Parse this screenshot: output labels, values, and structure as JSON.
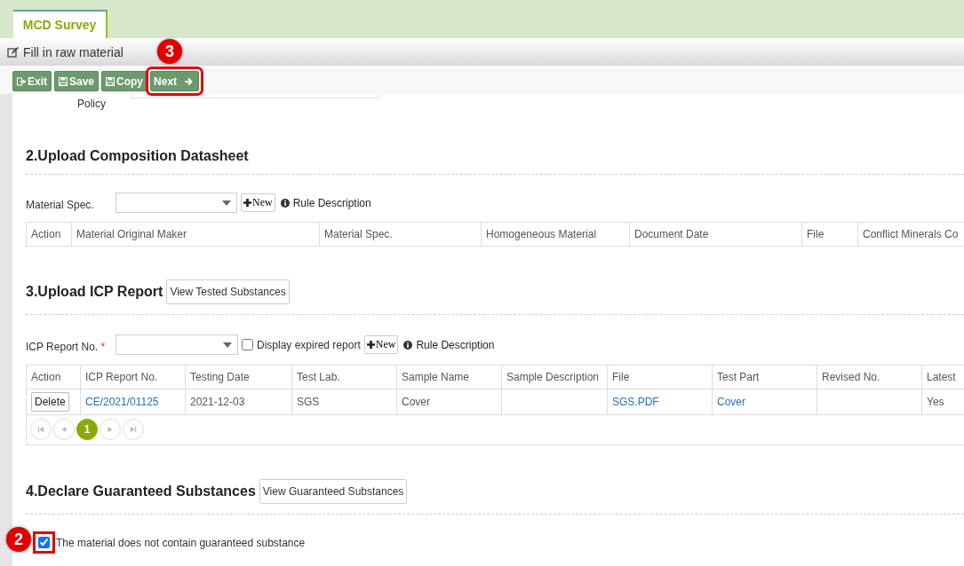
{
  "tabs": [
    {
      "label": "MCD Survey",
      "selected": true
    }
  ],
  "header": {
    "title": "Fill in raw material"
  },
  "toolbar": [
    {
      "label": "Exit",
      "kind": "exit"
    },
    {
      "label": "Save",
      "kind": "save"
    },
    {
      "label": "Copy",
      "kind": "save"
    },
    {
      "label": "Next",
      "kind": "next",
      "callout": "3"
    }
  ],
  "policy": {
    "label": "Policy"
  },
  "section_2": {
    "heading": "2.Upload Composition Datasheet",
    "field_label": "Material Spec.",
    "new_button": "New",
    "rule_link": "Rule Description",
    "table": {
      "columns": [
        "Action",
        "Material Original Maker",
        "Material Spec.",
        "Homogeneous Material",
        "Document Date",
        "File",
        "Conflict Minerals Co"
      ]
    }
  },
  "section_3": {
    "heading": "3.Upload ICP Report",
    "view_button": "View Tested Substances",
    "field_label": "ICP Report No.",
    "required_mark": "*",
    "expired_checkbox": {
      "label": "Display expired report",
      "checked": false
    },
    "new_button": "New",
    "rule_link": "Rule Description",
    "table": {
      "columns": [
        "Action",
        "ICP Report No.",
        "Testing Date",
        "Test Lab.",
        "Sample Name",
        "Sample Description",
        "File",
        "Test Part",
        "Revised No.",
        "Latest"
      ],
      "rows": [
        {
          "action": "Delete",
          "report_no": "CE/2021/01125",
          "testing_date": "2021-12-03",
          "test_lab": "SGS",
          "sample_name": "Cover",
          "sample_description": "",
          "file": "SGS.PDF",
          "test_part": "Cover",
          "revised_no": "",
          "latest": "Yes"
        }
      ]
    },
    "pager": [
      {
        "kind": "first"
      },
      {
        "kind": "prev"
      },
      {
        "kind": "page",
        "label": "1",
        "selected": true
      },
      {
        "kind": "next"
      },
      {
        "kind": "last"
      }
    ]
  },
  "section_4": {
    "heading": "4.Declare Guaranteed Substances",
    "view_button": "View Guaranteed Substances",
    "declaration": {
      "label": "The material does not contain guaranteed substance",
      "checked": true,
      "callout": "2"
    }
  }
}
